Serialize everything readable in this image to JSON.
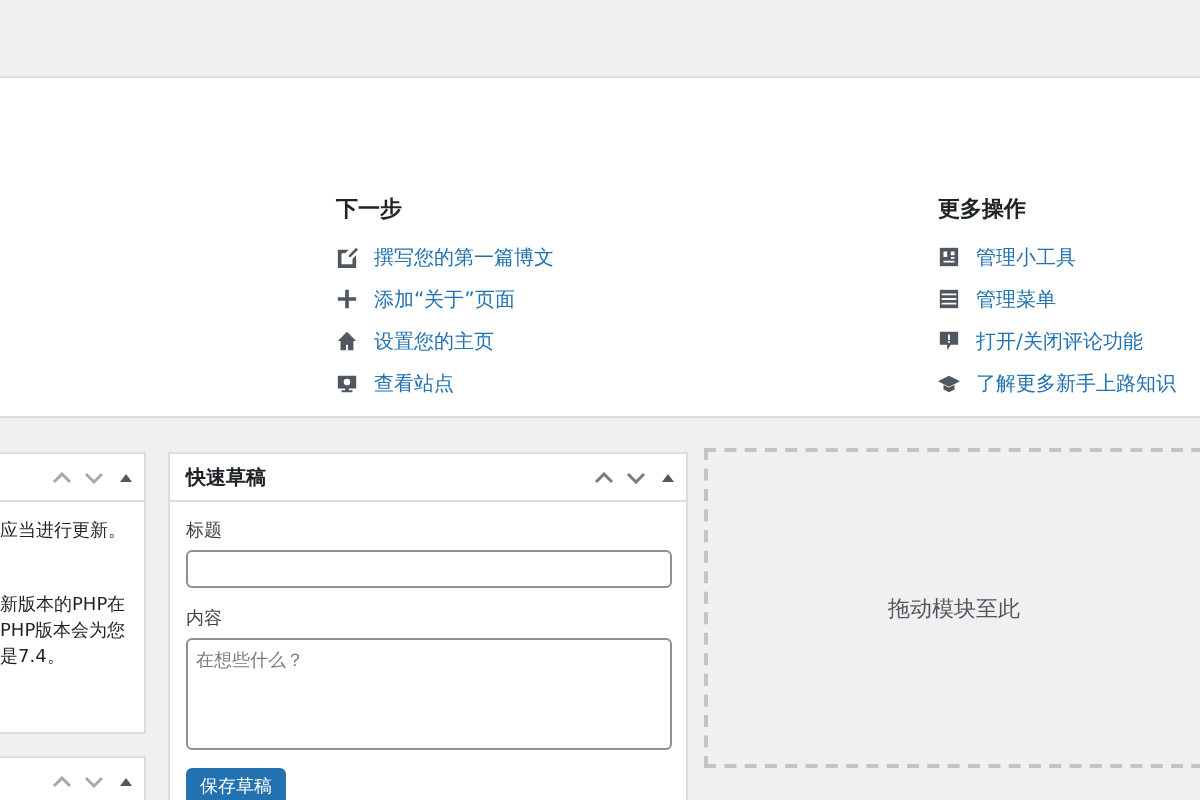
{
  "welcome": {
    "columns": [
      {
        "title": "下一步",
        "items": [
          {
            "kind": "edit",
            "label": "撰写您的第一篇博文"
          },
          {
            "kind": "plus",
            "label": "添加“关于”页面"
          },
          {
            "kind": "home",
            "label": "设置您的主页"
          },
          {
            "kind": "view",
            "label": "查看站点"
          }
        ]
      },
      {
        "title": "更多操作",
        "items": [
          {
            "kind": "widgets",
            "label": "管理小工具"
          },
          {
            "kind": "menu",
            "label": "管理菜单"
          },
          {
            "kind": "comment",
            "label": "打开/关闭评论功能"
          },
          {
            "kind": "learn",
            "label": "了解更多新手上路知识"
          }
        ]
      }
    ]
  },
  "left_panel": {
    "paragraphs": [
      [
        "应当进行更新。"
      ],
      [
        "新版本的PHP在",
        "PHP版本会为您",
        "是7.4。"
      ]
    ]
  },
  "quick_draft": {
    "title": "快速草稿",
    "title_label": "标题",
    "content_label": "内容",
    "content_placeholder": "在想些什么？",
    "button": "保存草稿"
  },
  "drop_zone": {
    "label": "拖动模块至此"
  }
}
